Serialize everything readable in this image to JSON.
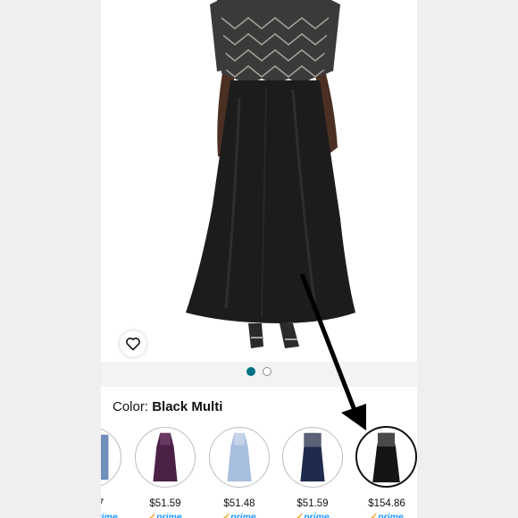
{
  "product": {
    "image_alt": "Black beaded chiffon gown",
    "carousel": {
      "pages": 2,
      "active_index": 0
    }
  },
  "color": {
    "label": "Color:",
    "selected": "Black Multi"
  },
  "swatches": [
    {
      "name": "partial-left",
      "price": "7",
      "prime": "prime",
      "color": "#6f8fb8"
    },
    {
      "name": "plum",
      "price": "$51.59",
      "prime": "prime",
      "color": "#4b2146"
    },
    {
      "name": "light-blue",
      "price": "$51.48",
      "prime": "prime",
      "color": "#a9bfdf"
    },
    {
      "name": "navy",
      "price": "$51.59",
      "prime": "prime",
      "color": "#1f2b4d"
    },
    {
      "name": "black-multi",
      "price": "$154.86",
      "prime": "prime",
      "color": "#151515",
      "selected": true
    }
  ],
  "colors": {
    "accent": "#007185",
    "prime_blue": "#1a98ff",
    "prime_check": "#f0a41c"
  }
}
